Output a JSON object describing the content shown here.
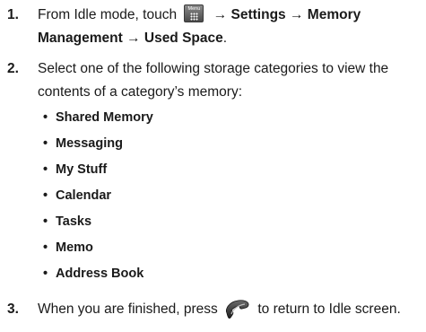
{
  "steps": [
    {
      "number": "1.",
      "prefix": "From Idle mode, touch",
      "menu_key_label": "Menu",
      "arrow": "→",
      "bold_settings": "Settings",
      "bold_memory": "Memory",
      "bold_management": "Management",
      "bold_used_space": "Used Space",
      "suffix": "."
    },
    {
      "number": "2.",
      "line1": "Select one of the following storage categories to view the",
      "line2": "contents of a category’s memory:"
    },
    {
      "number": "3.",
      "prefix": "When you are finished, press",
      "end_key_icon": "end-call-key-icon",
      "suffix": "to return to Idle screen."
    }
  ],
  "categories": [
    "Shared Memory",
    "Messaging",
    "My Stuff",
    "Calendar",
    "Tasks",
    "Memo",
    "Address Book"
  ],
  "bullet_char": "•"
}
